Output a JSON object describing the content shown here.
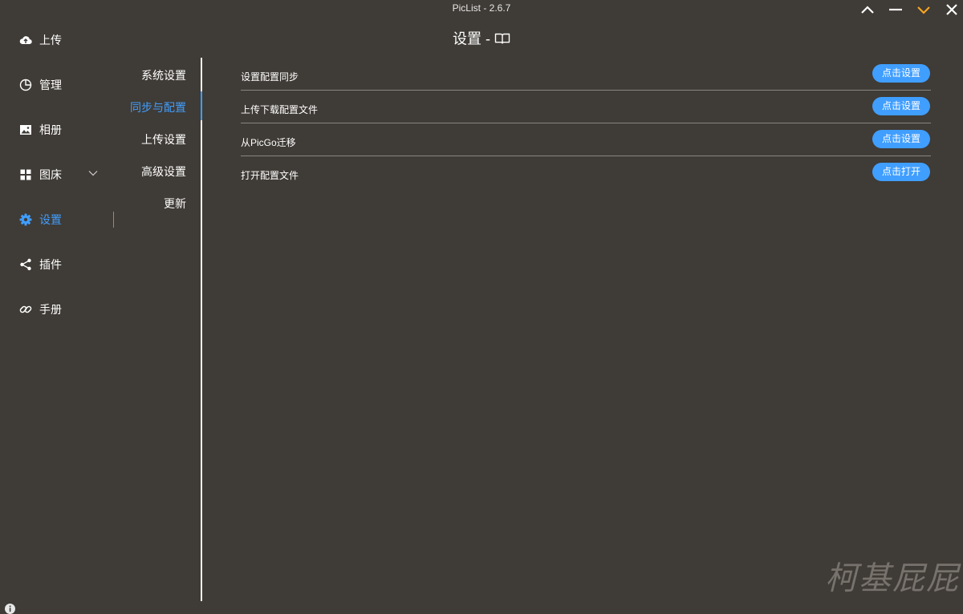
{
  "app": {
    "title": "PicList - 2.6.7"
  },
  "window_controls": {
    "accent_color": "#f5a623",
    "items": [
      "chevron-up-icon",
      "minimize-icon",
      "chevron-down-icon",
      "close-icon"
    ]
  },
  "sidebar": {
    "items": [
      {
        "label": "上传",
        "icon": "upload-cloud-icon"
      },
      {
        "label": "管理",
        "icon": "pie-chart-icon"
      },
      {
        "label": "相册",
        "icon": "image-icon"
      },
      {
        "label": "图床",
        "icon": "grid-icon"
      },
      {
        "label": "设置",
        "icon": "gear-icon",
        "active": true
      },
      {
        "label": "插件",
        "icon": "share-icon"
      },
      {
        "label": "手册",
        "icon": "link-icon"
      }
    ]
  },
  "subnav": {
    "items": [
      {
        "label": "系统设置"
      },
      {
        "label": "同步与配置",
        "active": true
      },
      {
        "label": "上传设置"
      },
      {
        "label": "高级设置"
      },
      {
        "label": "更新"
      }
    ]
  },
  "page": {
    "title": "设置 -",
    "title_icon": "book-icon"
  },
  "settings": {
    "rows": [
      {
        "label": "设置配置同步",
        "button": "点击设置"
      },
      {
        "label": "上传下载配置文件",
        "button": "点击设置"
      },
      {
        "label": "从PicGo迁移",
        "button": "点击设置"
      },
      {
        "label": "打开配置文件",
        "button": "点击打开"
      }
    ]
  },
  "watermark": {
    "text": "柯基屁屁"
  },
  "colors": {
    "background": "#3f3b36",
    "accent": "#409eff",
    "text": "#ffffff"
  }
}
